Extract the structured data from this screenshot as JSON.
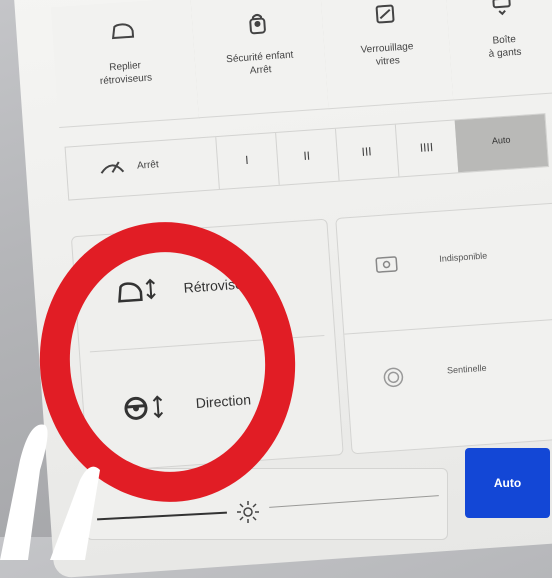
{
  "controls": {
    "fold_mirrors": "Replier\nrétroviseurs",
    "child_lock": "Sécurité enfant\nArrêt",
    "window_lock": "Verrouillage\nvitres",
    "glovebox": "Boîte\nà gants"
  },
  "wipers": {
    "off_label": "Arrêt",
    "speeds": [
      "I",
      "II",
      "III",
      "IIII"
    ],
    "auto_label": "Auto"
  },
  "adjust": {
    "mirrors_label": "Rétroviseurs",
    "steering_label": "Direction"
  },
  "status": {
    "unavailable_label": "Indisponible",
    "sentry_label": "Sentinelle"
  },
  "brightness": {
    "auto_button": "Auto"
  },
  "colors": {
    "accent": "#1347d6",
    "annotation": "#e11d25"
  }
}
